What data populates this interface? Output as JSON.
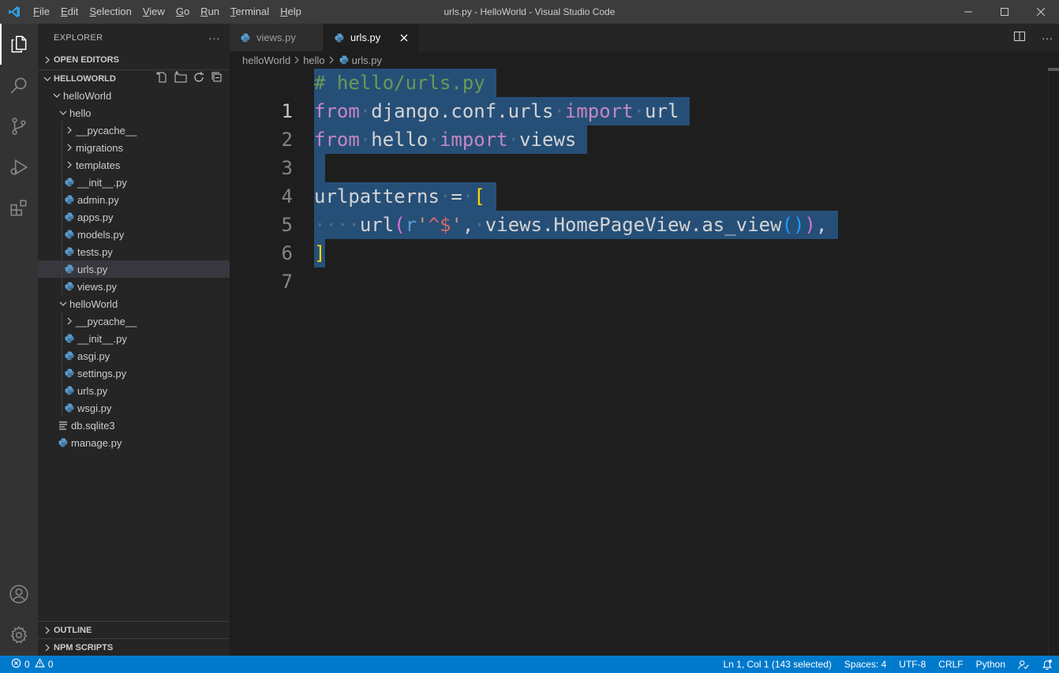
{
  "window": {
    "title": "urls.py - HelloWorld - Visual Studio Code",
    "menu": [
      {
        "u": "F",
        "rest": "ile"
      },
      {
        "u": "E",
        "rest": "dit"
      },
      {
        "u": "S",
        "rest": "election"
      },
      {
        "u": "V",
        "rest": "iew"
      },
      {
        "u": "G",
        "rest": "o"
      },
      {
        "u": "R",
        "rest": "un"
      },
      {
        "u": "T",
        "rest": "erminal"
      },
      {
        "u": "H",
        "rest": "elp"
      }
    ]
  },
  "sidebar": {
    "title": "EXPLORER",
    "more": "···",
    "open_editors": "OPEN EDITORS",
    "workspace": "HELLOWORLD",
    "tree": {
      "root": "helloWorld",
      "hello": "hello",
      "hello_pycache": "__pycache__",
      "migrations": "migrations",
      "templates": "templates",
      "hello_init": "__init__.py",
      "admin": "admin.py",
      "apps": "apps.py",
      "models": "models.py",
      "tests": "tests.py",
      "hello_urls": "urls.py",
      "views": "views.py",
      "helloWorld_pkg": "helloWorld",
      "pkg_pycache": "__pycache__",
      "pkg_init": "__init__.py",
      "asgi": "asgi.py",
      "settings": "settings.py",
      "pkg_urls": "urls.py",
      "wsgi": "wsgi.py",
      "db": "db.sqlite3",
      "manage": "manage.py"
    },
    "outline": "OUTLINE",
    "npm": "NPM SCRIPTS"
  },
  "editor": {
    "tabs": [
      {
        "label": "views.py"
      },
      {
        "label": "urls.py"
      }
    ],
    "breadcrumb": [
      "helloWorld",
      "hello",
      "urls.py"
    ],
    "line_numbers": [
      "1",
      "2",
      "3",
      "4",
      "5",
      "6",
      "7"
    ],
    "code": {
      "l1": "# hello/urls.py",
      "l2_from": "from",
      "l2_mod": "django.conf.urls",
      "l2_import": "import",
      "l2_name": "url",
      "l3_from": "from",
      "l3_mod": "hello",
      "l3_import": "import",
      "l3_name": "views",
      "l5_name": "urlpatterns",
      "l5_eq": "=",
      "l5_br": "[",
      "l6_indent": "···",
      "l6_fn": "url",
      "l6_p1": "(",
      "l6_pfx": "r",
      "l6_q1": "'",
      "l6_re": "^$",
      "l6_q2": "'",
      "l6_comma": ",",
      "l6_call": "views.HomePageView.as_view",
      "l6_p2": "(",
      "l6_p3": ")",
      "l6_p4": ")",
      "l6_end": ",",
      "l7_br": "]"
    }
  },
  "status": {
    "errors": "0",
    "warnings": "0",
    "position": "Ln 1, Col 1 (143 selected)",
    "spaces": "Spaces: 4",
    "encoding": "UTF-8",
    "eol": "CRLF",
    "language": "Python"
  },
  "colors": {
    "accent": "#007acc",
    "selection": "#264f78"
  }
}
